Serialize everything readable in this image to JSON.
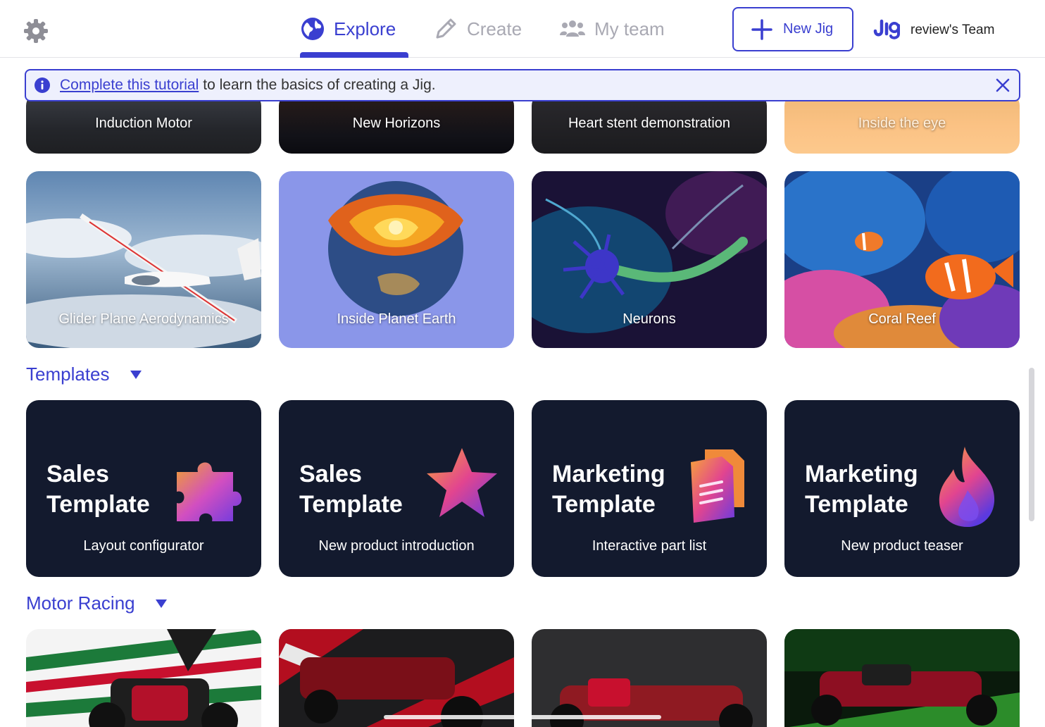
{
  "header": {
    "tabs": [
      {
        "label": "Explore",
        "icon": "globe-icon",
        "active": true
      },
      {
        "label": "Create",
        "icon": "pencil-icon",
        "active": false
      },
      {
        "label": "My team",
        "icon": "team-icon",
        "active": false
      }
    ],
    "new_jig_label": "New Jig",
    "team_name": "review's Team",
    "accent_color": "#3a3fd0"
  },
  "banner": {
    "link_text": "Complete this tutorial",
    "rest_text": "to learn the basics of creating a Jig."
  },
  "row1": [
    "Induction Motor",
    "New Horizons",
    "Heart stent demonstration",
    "Inside the eye"
  ],
  "row2": [
    "Glider Plane Aerodynamics",
    "Inside Planet Earth",
    "Neurons",
    "Coral Reef"
  ],
  "sections": {
    "templates": "Templates",
    "motor_racing": "Motor Racing"
  },
  "templates": [
    {
      "title_line1": "Sales",
      "title_line2": "Template",
      "subtitle": "Layout configurator",
      "icon": "puzzle-icon"
    },
    {
      "title_line1": "Sales",
      "title_line2": "Template",
      "subtitle": "New product introduction",
      "icon": "star-icon"
    },
    {
      "title_line1": "Marketing",
      "title_line2": "Template",
      "subtitle": "Interactive part list",
      "icon": "document-icon"
    },
    {
      "title_line1": "Marketing",
      "title_line2": "Template",
      "subtitle": "New product teaser",
      "icon": "flame-icon"
    }
  ]
}
